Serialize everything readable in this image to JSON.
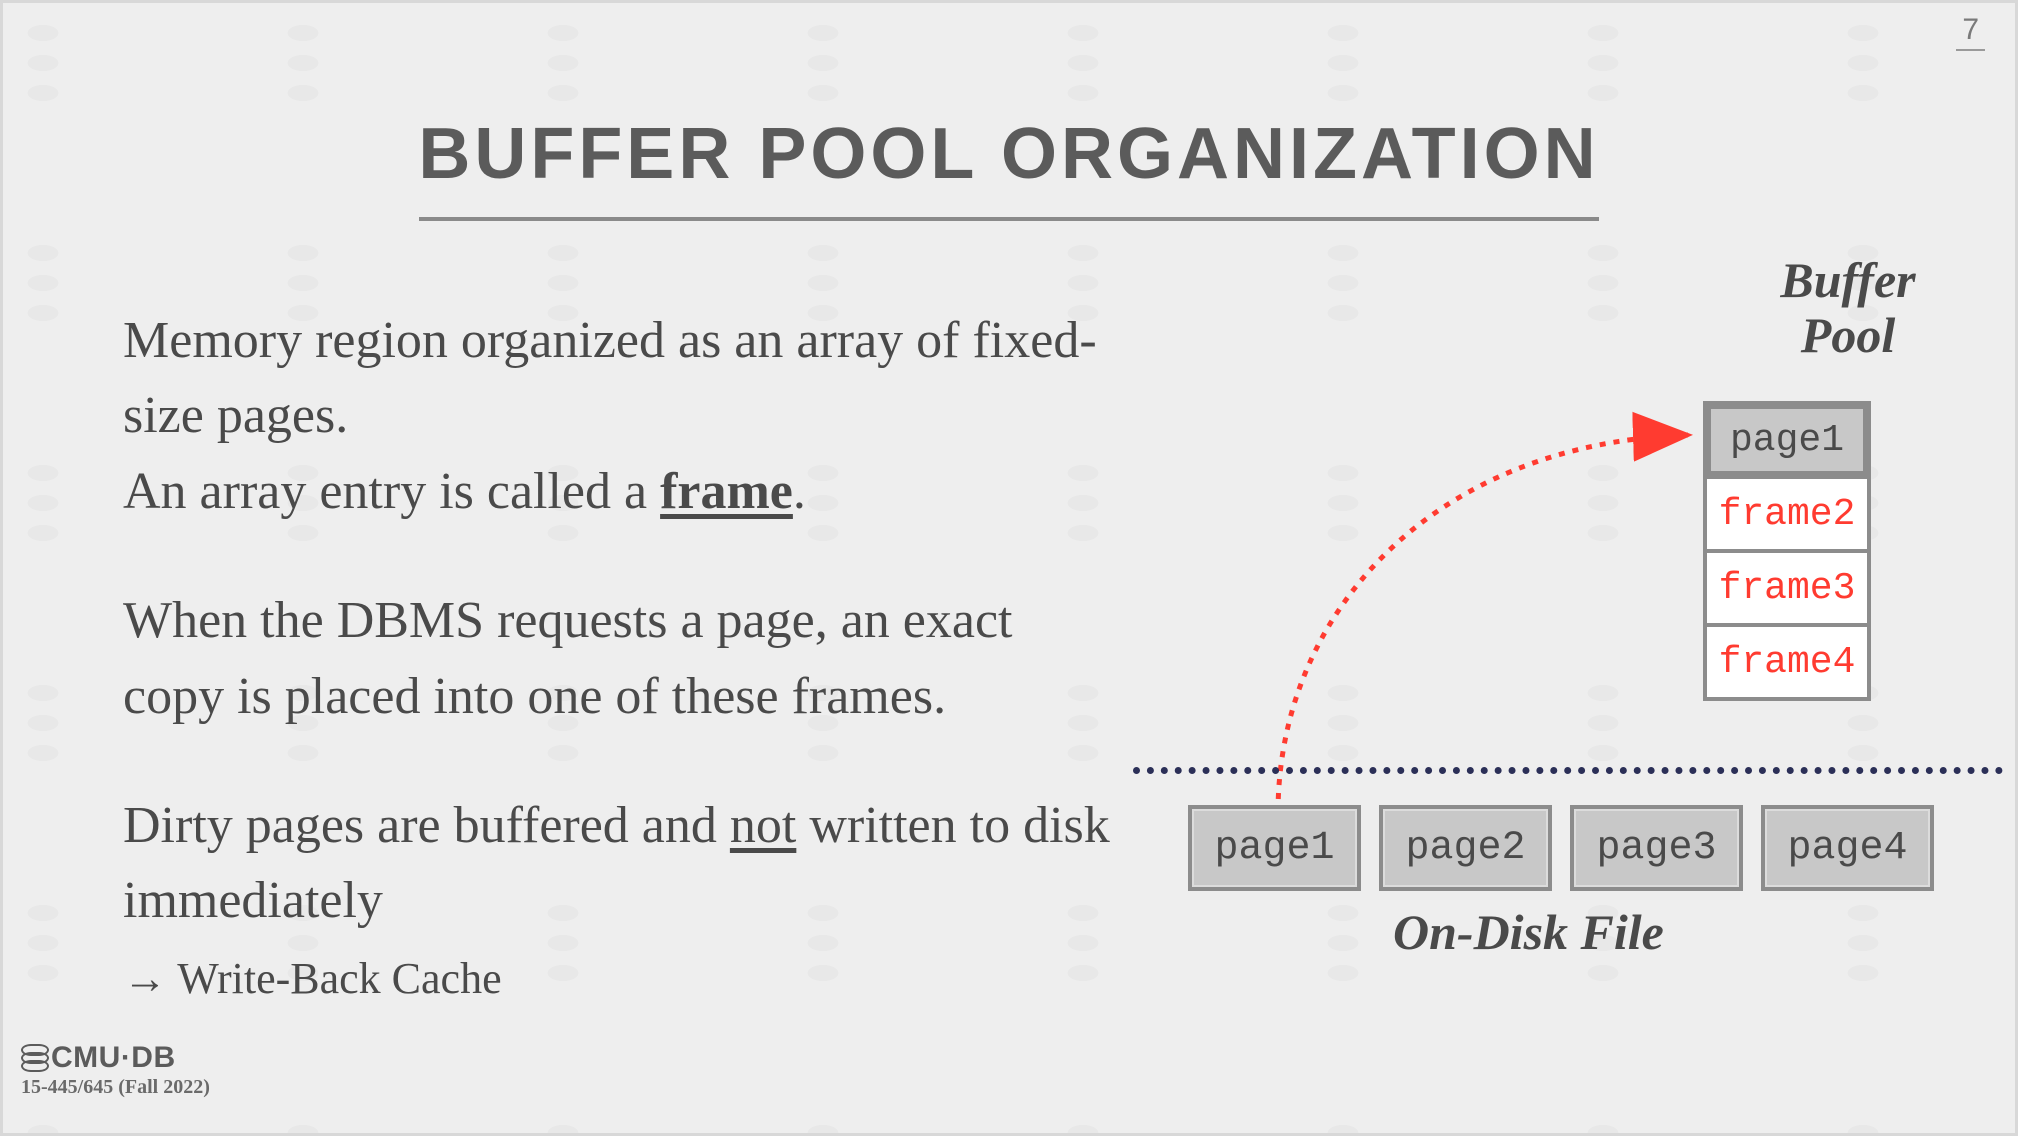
{
  "page_number": "7",
  "title": "BUFFER POOL ORGANIZATION",
  "paragraphs": {
    "p1a": "Memory region organized as an array of fixed-size pages.",
    "p1b_pre": "An array entry is called a ",
    "p1b_kw": "frame",
    "p1b_post": ".",
    "p2": "When the DBMS requests a page, an exact copy is placed into one of these frames.",
    "p3_pre": "Dirty pages are buffered and ",
    "p3_kw": "not",
    "p3_post": " written to disk immediately",
    "p3_sub": "→ Write-Back Cache"
  },
  "diagram": {
    "buffer_pool_label_line1": "Buffer",
    "buffer_pool_label_line2": "Pool",
    "frames": [
      {
        "label": "page1",
        "type": "page"
      },
      {
        "label": "frame2",
        "type": "frame"
      },
      {
        "label": "frame3",
        "type": "frame"
      },
      {
        "label": "frame4",
        "type": "frame"
      }
    ],
    "disk_pages": [
      "page1",
      "page2",
      "page3",
      "page4"
    ],
    "disk_label": "On-Disk File"
  },
  "footer": {
    "logo_text": "CMU·DB",
    "course": "15-445/645 (Fall 2022)"
  }
}
